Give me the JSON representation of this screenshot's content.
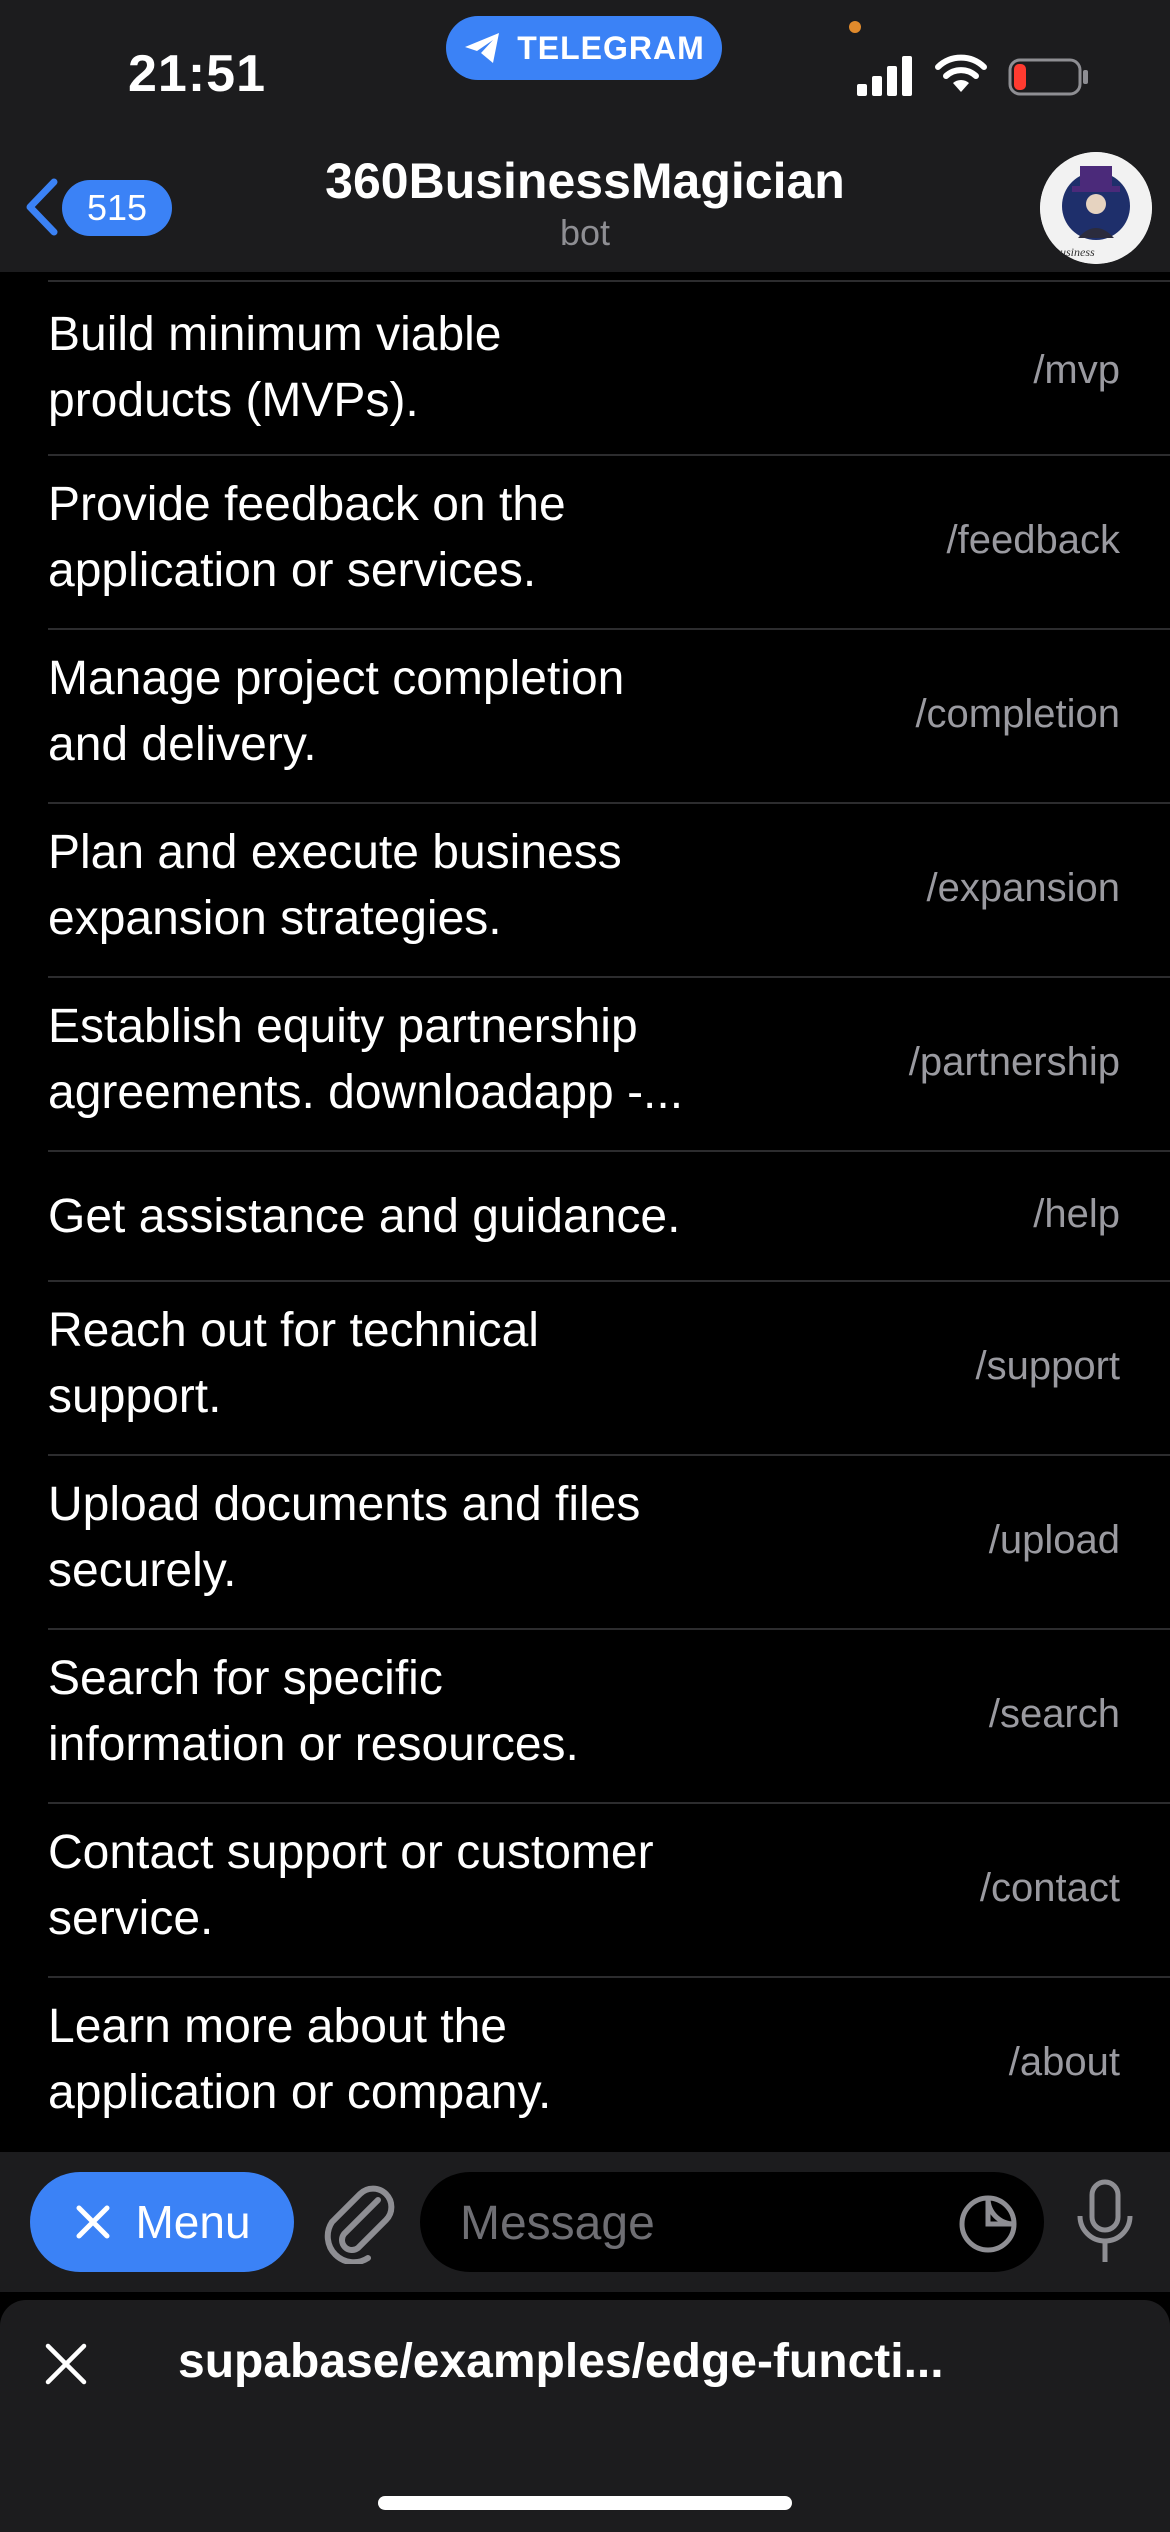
{
  "status_bar": {
    "time": "21:51",
    "app_pill": "TELEGRAM",
    "icons": [
      "signal-icon",
      "wifi-icon",
      "battery-icon"
    ]
  },
  "header": {
    "back_count": "515",
    "title": "360BusinessMagician",
    "subtitle": "bot",
    "avatar_icon": "bot-avatar"
  },
  "commands": [
    {
      "desc_line1": "Build minimum viable",
      "desc_line2": "products (MVPs).",
      "cmd": "/mvp"
    },
    {
      "desc_line1": "Provide feedback on the",
      "desc_line2": "application or services.",
      "cmd": "/feedback"
    },
    {
      "desc_line1": "Manage project completion",
      "desc_line2": "and delivery.",
      "cmd": "/completion"
    },
    {
      "desc_line1": "Plan and execute business",
      "desc_line2": "expansion strategies.",
      "cmd": "/expansion"
    },
    {
      "desc_line1": "Establish equity partnership",
      "desc_line2": "agreements. downloadapp -...",
      "cmd": "/partnership"
    },
    {
      "desc_line1": "Get assistance and guidance.",
      "desc_line2": "",
      "cmd": "/help"
    },
    {
      "desc_line1": "Reach out for technical",
      "desc_line2": "support.",
      "cmd": "/support"
    },
    {
      "desc_line1": "Upload documents and files",
      "desc_line2": "securely.",
      "cmd": "/upload"
    },
    {
      "desc_line1": "Search for specific",
      "desc_line2": "information or resources.",
      "cmd": "/search"
    },
    {
      "desc_line1": "Contact support or customer",
      "desc_line2": "service.",
      "cmd": "/contact"
    },
    {
      "desc_line1": "Learn more about the",
      "desc_line2": "application or company.",
      "cmd": "/about"
    }
  ],
  "input_bar": {
    "menu_label": "Menu",
    "placeholder": "Message"
  },
  "bottom_sheet": {
    "title": "supabase/examples/edge-functi..."
  },
  "colors": {
    "accent": "#3b82f6",
    "background": "#000000",
    "bar": "#1c1c1e",
    "muted_text": "#9a9aa0"
  }
}
